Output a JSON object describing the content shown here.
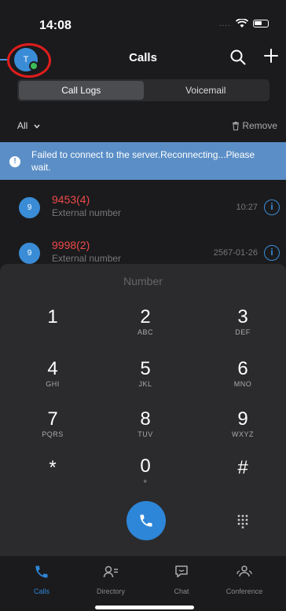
{
  "status_bar": {
    "time": "14:08",
    "signal": "...."
  },
  "header": {
    "avatar_initial": "T",
    "title": "Calls"
  },
  "segments": [
    {
      "label": "Call Logs",
      "active": true
    },
    {
      "label": "Voicemail",
      "active": false
    }
  ],
  "filter": {
    "label": "All",
    "remove_label": "Remove"
  },
  "banner": {
    "text": "Failed to connect to the server.Reconnecting...Please wait.",
    "icon": "!"
  },
  "call_logs": [
    {
      "avatar": "9",
      "number": "9453(4)",
      "type": "External number",
      "time": "10:27"
    },
    {
      "avatar": "9",
      "number": "9998(2)",
      "type": "External number",
      "time": "2567-01-26"
    }
  ],
  "dialpad": {
    "placeholder": "Number",
    "keys": [
      {
        "digit": "1",
        "letters": ""
      },
      {
        "digit": "2",
        "letters": "ABC"
      },
      {
        "digit": "3",
        "letters": "DEF"
      },
      {
        "digit": "4",
        "letters": "GHI"
      },
      {
        "digit": "5",
        "letters": "JKL"
      },
      {
        "digit": "6",
        "letters": "MNO"
      },
      {
        "digit": "7",
        "letters": "PQRS"
      },
      {
        "digit": "8",
        "letters": "TUV"
      },
      {
        "digit": "9",
        "letters": "WXYZ"
      },
      {
        "digit": "*",
        "letters": ""
      },
      {
        "digit": "0",
        "letters": "+"
      },
      {
        "digit": "#",
        "letters": ""
      }
    ]
  },
  "tabs": [
    {
      "label": "Calls",
      "icon": "phone-icon",
      "active": true
    },
    {
      "label": "Directory",
      "icon": "contacts-icon",
      "active": false
    },
    {
      "label": "Chat",
      "icon": "chat-icon",
      "active": false
    },
    {
      "label": "Conference",
      "icon": "conference-icon",
      "active": false
    }
  ],
  "colors": {
    "accent": "#2e86d8",
    "missed": "#ef4a4a",
    "banner": "#5b8ec6",
    "highlight_ring": "#e11c1c"
  }
}
